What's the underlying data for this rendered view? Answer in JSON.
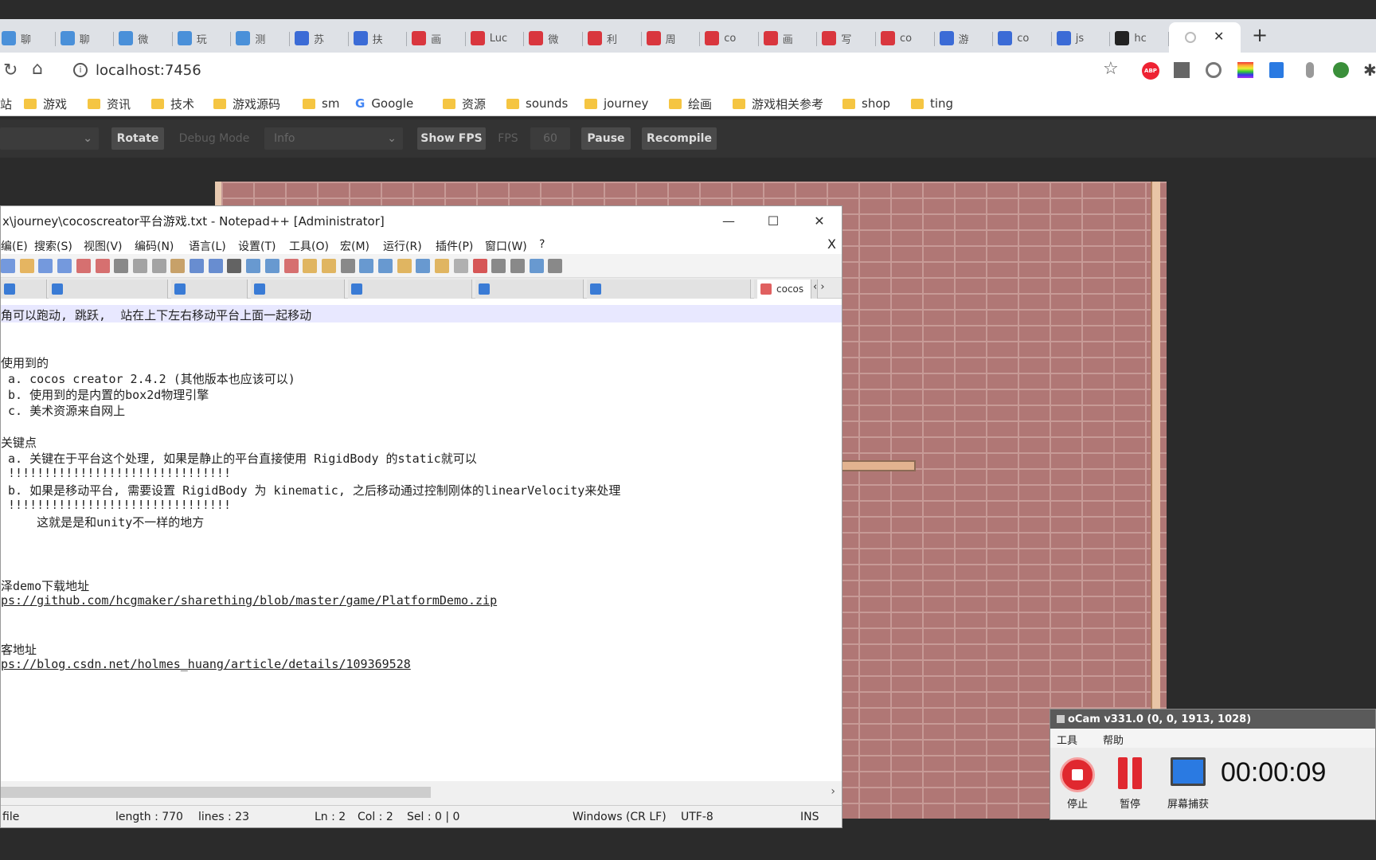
{
  "browser": {
    "tabs": [
      {
        "label": "聊",
        "color": "#4a90d9"
      },
      {
        "label": "聊",
        "color": "#4a90d9"
      },
      {
        "label": "微",
        "color": "#4a90d9"
      },
      {
        "label": "玩",
        "color": "#4a90d9"
      },
      {
        "label": "测",
        "color": "#4a90d9"
      },
      {
        "label": "苏",
        "color": "#3b6bd6"
      },
      {
        "label": "扶",
        "color": "#3b6bd6"
      },
      {
        "label": "画",
        "color": "#d9363e"
      },
      {
        "label": "Luc",
        "color": "#d9363e"
      },
      {
        "label": "微",
        "color": "#d9363e"
      },
      {
        "label": "利",
        "color": "#d9363e"
      },
      {
        "label": "周",
        "color": "#d9363e"
      },
      {
        "label": "co",
        "color": "#d9363e"
      },
      {
        "label": "画",
        "color": "#d9363e"
      },
      {
        "label": "写",
        "color": "#d9363e"
      },
      {
        "label": "co",
        "color": "#d9363e"
      },
      {
        "label": "游",
        "color": "#3b6bd6"
      },
      {
        "label": "co",
        "color": "#3b6bd6"
      },
      {
        "label": "js",
        "color": "#3b6bd6"
      },
      {
        "label": "hc",
        "color": "#222222"
      }
    ],
    "active_tab_label": "",
    "new_tab_label": "+",
    "close_tab_label": "✕",
    "address": "localhost:7456",
    "bookmarks": [
      "站",
      "游戏",
      "资讯",
      "技术",
      "游戏源码",
      "sm",
      "Google",
      "资源",
      "sounds",
      "journey",
      "绘画",
      "游戏相关参考",
      "shop",
      "ting"
    ]
  },
  "cocos_toolbar": {
    "rotate": "Rotate",
    "debug_mode": "Debug Mode",
    "info": "Info",
    "show_fps": "Show FPS",
    "fps_label": "FPS",
    "fps_value": "60",
    "pause": "Pause",
    "recompile": "Recompile"
  },
  "notepad": {
    "title": "x\\journey\\cocoscreator平台游戏.txt - Notepad++ [Administrator]",
    "minimize": "—",
    "maximize": "☐",
    "close": "✕",
    "doc_close": "X",
    "menu": [
      "编(E)",
      "搜索(S)",
      "视图(V)",
      "编码(N)",
      "语言(L)",
      "设置(T)",
      "工具(O)",
      "宏(M)",
      "运行(R)",
      "插件(P)",
      "窗口(W)",
      "?"
    ],
    "tabs": [
      "",
      "",
      "",
      "",
      "",
      "",
      "",
      "",
      "cocos"
    ],
    "lines": [
      "角可以跑动, 跳跃,  站在上下左右移动平台上面一起移动",
      "",
      "",
      "使用到的",
      " a. cocos creator 2.4.2 (其他版本也应该可以)",
      " b. 使用到的是内置的box2d物理引擎",
      " c. 美术资源来自网上",
      "",
      "关键点",
      " a. 关键在于平台这个处理, 如果是静止的平台直接使用 RigidBody 的static就可以",
      " !!!!!!!!!!!!!!!!!!!!!!!!!!!!!!!",
      " b. 如果是移动平台, 需要设置 RigidBody 为 kinematic, 之后移动通过控制刚体的linearVelocity来处理",
      " !!!!!!!!!!!!!!!!!!!!!!!!!!!!!!!",
      "     这就是是和unity不一样的地方",
      "",
      "",
      "",
      "泽demo下载地址",
      "ps://github.com/hcgmaker/sharething/blob/master/game/PlatformDemo.zip",
      "",
      "",
      "客地址",
      "ps://blog.csdn.net/holmes_huang/article/details/109369528"
    ],
    "status": {
      "file": "file",
      "length": "length : 770",
      "lines": "lines : 23",
      "ln": "Ln : 2",
      "col": "Col : 2",
      "sel": "Sel : 0 | 0",
      "eol": "Windows (CR LF)",
      "encoding": "UTF-8",
      "mode": "INS"
    }
  },
  "ocam": {
    "title": "oCam v331.0 (0, 0, 1913, 1028)",
    "menu_tools": "工具",
    "menu_help": "帮助",
    "stop": "停止",
    "pause": "暂停",
    "capture": "屏幕捕获",
    "timer": "00:00:09"
  },
  "colors": {
    "brick": "#b07775",
    "mortar": "#c79a96",
    "ocam_red": "#e0282f"
  }
}
